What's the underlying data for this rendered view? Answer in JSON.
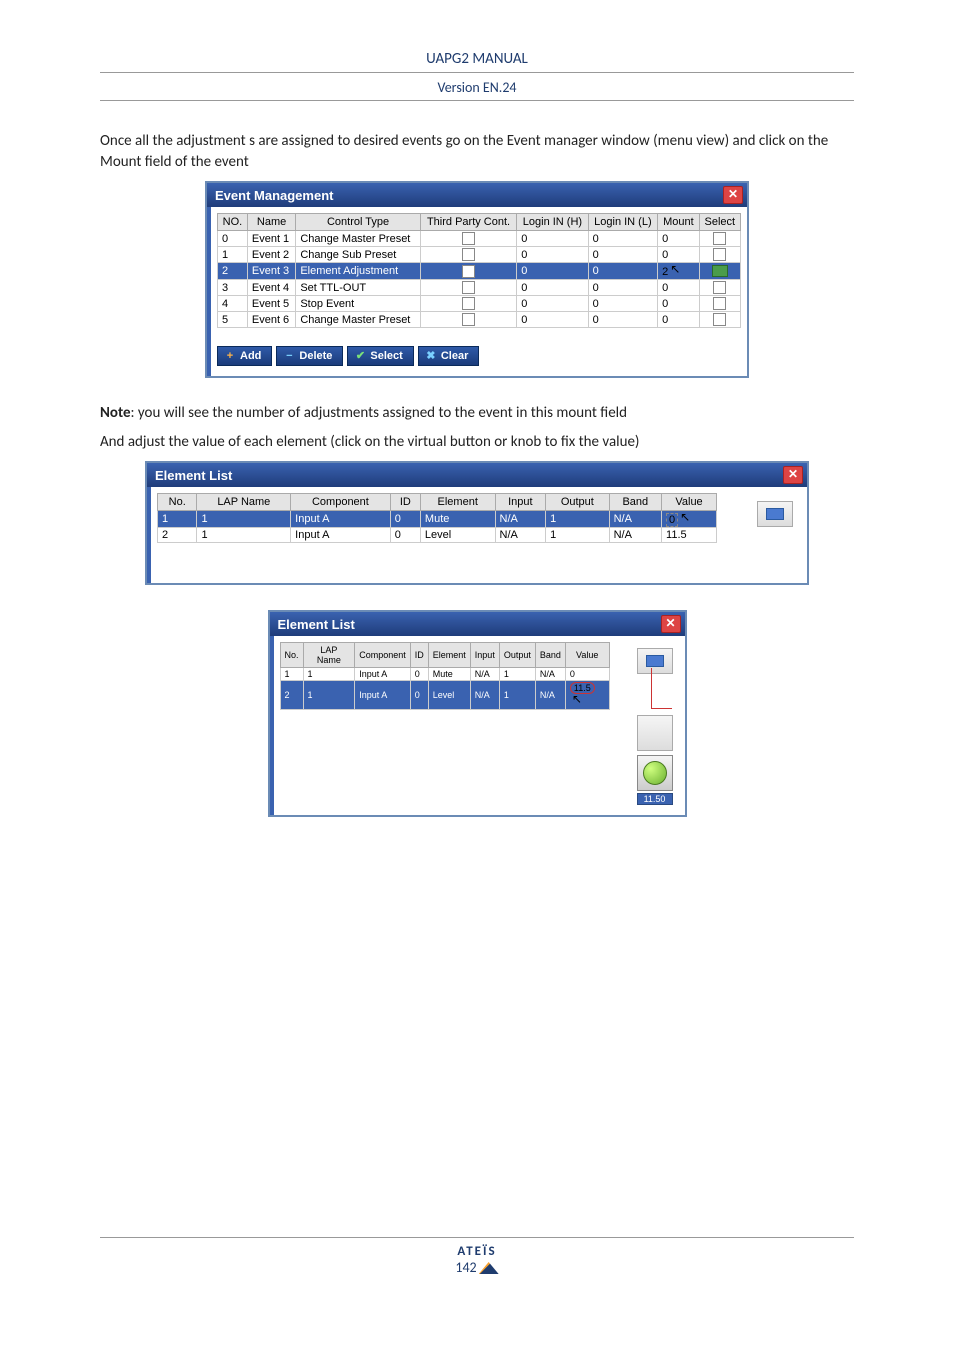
{
  "header": {
    "title": "UAPG2 MANUAL",
    "version": "Version EN.24"
  },
  "para1": "Once all the adjustment s are assigned to desired events go on the Event manager window (menu view) and click on the Mount field of the event",
  "note_label": "Note",
  "note_text": ": you will see the number of adjustments assigned to the event in this mount field",
  "note_line2": "And adjust the value of each element (click on the virtual button or knob to fix the value)",
  "event_mgmt": {
    "title": "Event Management",
    "headers": [
      "NO.",
      "Name",
      "Control Type",
      "Third Party Cont.",
      "Login IN (H)",
      "Login IN (L)",
      "Mount",
      "Select"
    ],
    "rows": [
      {
        "no": "0",
        "name": "Event 1",
        "ctype": "Change Master Preset",
        "h": "0",
        "l": "0",
        "mount": "0"
      },
      {
        "no": "1",
        "name": "Event 2",
        "ctype": "Change Sub Preset",
        "h": "0",
        "l": "0",
        "mount": "0"
      },
      {
        "no": "2",
        "name": "Event 3",
        "ctype": "Element Adjustment",
        "h": "0",
        "l": "0",
        "mount": "2",
        "sel": true
      },
      {
        "no": "3",
        "name": "Event 4",
        "ctype": "Set TTL-OUT",
        "h": "0",
        "l": "0",
        "mount": "0"
      },
      {
        "no": "4",
        "name": "Event 5",
        "ctype": "Stop Event",
        "h": "0",
        "l": "0",
        "mount": "0"
      },
      {
        "no": "5",
        "name": "Event 6",
        "ctype": "Change Master Preset",
        "h": "0",
        "l": "0",
        "mount": "0"
      }
    ],
    "buttons": {
      "add": "Add",
      "delete": "Delete",
      "select": "Select",
      "clear": "Clear"
    }
  },
  "element_list": {
    "title": "Element List",
    "headers": [
      "No.",
      "LAP Name",
      "Component",
      "ID",
      "Element",
      "Input",
      "Output",
      "Band",
      "Value"
    ],
    "rows": [
      {
        "no": "1",
        "lap": "1",
        "comp": "Input A",
        "id": "0",
        "el": "Mute",
        "in": "N/A",
        "out": "1",
        "band": "N/A",
        "val": "0",
        "sel": true
      },
      {
        "no": "2",
        "lap": "1",
        "comp": "Input A",
        "id": "0",
        "el": "Level",
        "in": "N/A",
        "out": "1",
        "band": "N/A",
        "val": "11.5"
      }
    ]
  },
  "element_list2": {
    "title": "Element List",
    "rows": [
      {
        "no": "1",
        "lap": "1",
        "comp": "Input A",
        "id": "0",
        "el": "Mute",
        "in": "N/A",
        "out": "1",
        "band": "N/A",
        "val": "0"
      },
      {
        "no": "2",
        "lap": "1",
        "comp": "Input A",
        "id": "0",
        "el": "Level",
        "in": "N/A",
        "out": "1",
        "band": "N/A",
        "val": "11.5",
        "sel": true
      }
    ],
    "knob_value": "11.50"
  },
  "footer": {
    "brand": "ATEÏS",
    "page": "142"
  }
}
